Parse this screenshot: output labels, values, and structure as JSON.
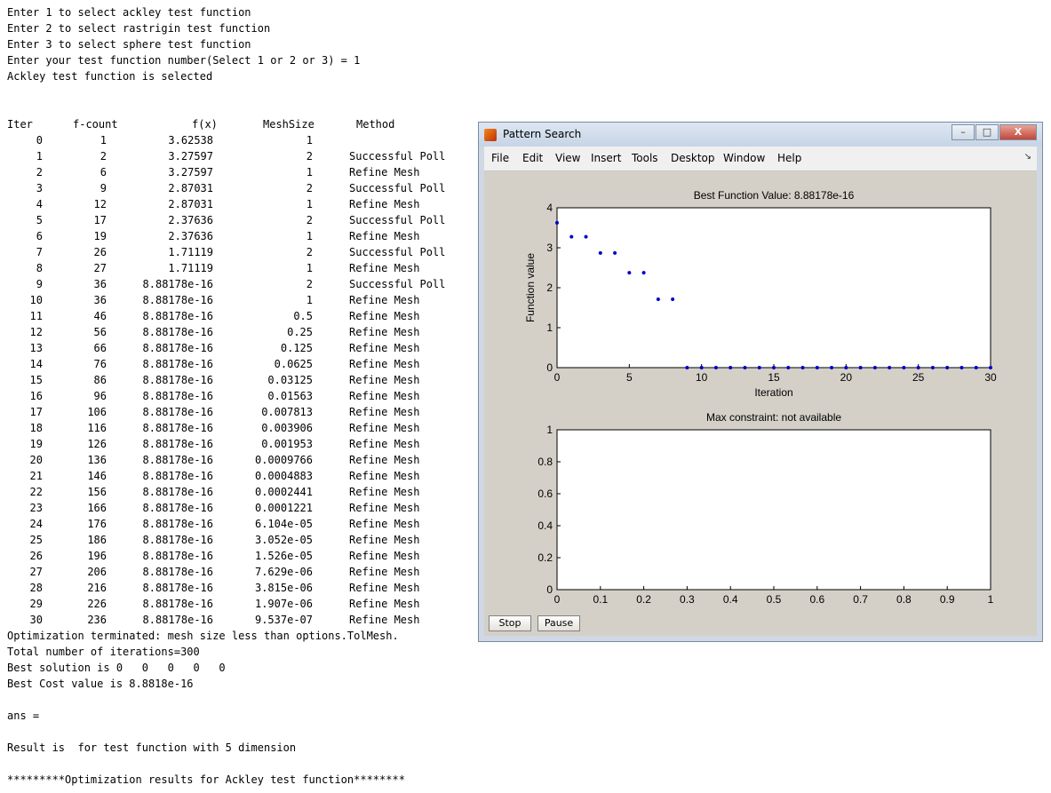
{
  "console": {
    "intro": [
      "Enter 1 to select ackley test function",
      "Enter 2 to select rastrigin test function",
      "Enter 3 to select sphere test function",
      "Enter your test function number(Select 1 or 2 or 3) = 1",
      "Ackley test function is selected"
    ],
    "table": {
      "headers": [
        "Iter",
        "f-count",
        "f(x)",
        "MeshSize",
        "Method"
      ],
      "rows": [
        [
          "0",
          "1",
          "3.62538",
          "1",
          ""
        ],
        [
          "1",
          "2",
          "3.27597",
          "2",
          "Successful Poll"
        ],
        [
          "2",
          "6",
          "3.27597",
          "1",
          "Refine Mesh"
        ],
        [
          "3",
          "9",
          "2.87031",
          "2",
          "Successful Poll"
        ],
        [
          "4",
          "12",
          "2.87031",
          "1",
          "Refine Mesh"
        ],
        [
          "5",
          "17",
          "2.37636",
          "2",
          "Successful Poll"
        ],
        [
          "6",
          "19",
          "2.37636",
          "1",
          "Refine Mesh"
        ],
        [
          "7",
          "26",
          "1.71119",
          "2",
          "Successful Poll"
        ],
        [
          "8",
          "27",
          "1.71119",
          "1",
          "Refine Mesh"
        ],
        [
          "9",
          "36",
          "8.88178e-16",
          "2",
          "Successful Poll"
        ],
        [
          "10",
          "36",
          "8.88178e-16",
          "1",
          "Refine Mesh"
        ],
        [
          "11",
          "46",
          "8.88178e-16",
          "0.5",
          "Refine Mesh"
        ],
        [
          "12",
          "56",
          "8.88178e-16",
          "0.25",
          "Refine Mesh"
        ],
        [
          "13",
          "66",
          "8.88178e-16",
          "0.125",
          "Refine Mesh"
        ],
        [
          "14",
          "76",
          "8.88178e-16",
          "0.0625",
          "Refine Mesh"
        ],
        [
          "15",
          "86",
          "8.88178e-16",
          "0.03125",
          "Refine Mesh"
        ],
        [
          "16",
          "96",
          "8.88178e-16",
          "0.01563",
          "Refine Mesh"
        ],
        [
          "17",
          "106",
          "8.88178e-16",
          "0.007813",
          "Refine Mesh"
        ],
        [
          "18",
          "116",
          "8.88178e-16",
          "0.003906",
          "Refine Mesh"
        ],
        [
          "19",
          "126",
          "8.88178e-16",
          "0.001953",
          "Refine Mesh"
        ],
        [
          "20",
          "136",
          "8.88178e-16",
          "0.0009766",
          "Refine Mesh"
        ],
        [
          "21",
          "146",
          "8.88178e-16",
          "0.0004883",
          "Refine Mesh"
        ],
        [
          "22",
          "156",
          "8.88178e-16",
          "0.0002441",
          "Refine Mesh"
        ],
        [
          "23",
          "166",
          "8.88178e-16",
          "0.0001221",
          "Refine Mesh"
        ],
        [
          "24",
          "176",
          "8.88178e-16",
          "6.104e-05",
          "Refine Mesh"
        ],
        [
          "25",
          "186",
          "8.88178e-16",
          "3.052e-05",
          "Refine Mesh"
        ],
        [
          "26",
          "196",
          "8.88178e-16",
          "1.526e-05",
          "Refine Mesh"
        ],
        [
          "27",
          "206",
          "8.88178e-16",
          "7.629e-06",
          "Refine Mesh"
        ],
        [
          "28",
          "216",
          "8.88178e-16",
          "3.815e-06",
          "Refine Mesh"
        ],
        [
          "29",
          "226",
          "8.88178e-16",
          "1.907e-06",
          "Refine Mesh"
        ],
        [
          "30",
          "236",
          "8.88178e-16",
          "9.537e-07",
          "Refine Mesh"
        ]
      ]
    },
    "outro": [
      "Optimization terminated: mesh size less than options.TolMesh.",
      "Total number of iterations=300",
      "Best solution is 0   0   0   0   0",
      "Best Cost value is 8.8818e-16",
      "",
      "ans =",
      "",
      "Result is  for test function with 5 dimension",
      "",
      "*********Optimization results for Ackley test function********"
    ]
  },
  "figure": {
    "window_title": "Pattern Search",
    "window_buttons": [
      "–",
      "□",
      "X"
    ],
    "menu": [
      "File",
      "Edit",
      "View",
      "Insert",
      "Tools",
      "Desktop",
      "Window",
      "Help"
    ],
    "menu_arrow": "↘",
    "buttons": {
      "stop": "Stop",
      "pause": "Pause"
    },
    "colors": {
      "marker": "#0000cc",
      "axes_bg": "#ffffff",
      "figure_bg": "#d4d0c8"
    }
  },
  "chart_data": [
    {
      "type": "scatter",
      "title": "Best Function Value: 8.88178e-16",
      "xlabel": "Iteration",
      "ylabel": "Function value",
      "xlim": [
        0,
        30
      ],
      "ylim": [
        0,
        4
      ],
      "xticks": [
        0,
        5,
        10,
        15,
        20,
        25,
        30
      ],
      "yticks": [
        0,
        1,
        2,
        3,
        4
      ],
      "x": [
        0,
        1,
        2,
        3,
        4,
        5,
        6,
        7,
        8,
        9,
        10,
        11,
        12,
        13,
        14,
        15,
        16,
        17,
        18,
        19,
        20,
        21,
        22,
        23,
        24,
        25,
        26,
        27,
        28,
        29,
        30
      ],
      "y": [
        3.62538,
        3.27597,
        3.27597,
        2.87031,
        2.87031,
        2.37636,
        2.37636,
        1.71119,
        1.71119,
        0,
        0,
        0,
        0,
        0,
        0,
        0,
        0,
        0,
        0,
        0,
        0,
        0,
        0,
        0,
        0,
        0,
        0,
        0,
        0,
        0,
        0
      ]
    },
    {
      "type": "scatter",
      "title": "Max constraint: not available",
      "xlabel": "",
      "ylabel": "",
      "xlim": [
        0,
        1
      ],
      "ylim": [
        0,
        1
      ],
      "xticks": [
        0,
        0.1,
        0.2,
        0.3,
        0.4,
        0.5,
        0.6,
        0.7,
        0.8,
        0.9,
        1
      ],
      "yticks": [
        0,
        0.2,
        0.4,
        0.6,
        0.8,
        1
      ],
      "x": [],
      "y": []
    }
  ]
}
